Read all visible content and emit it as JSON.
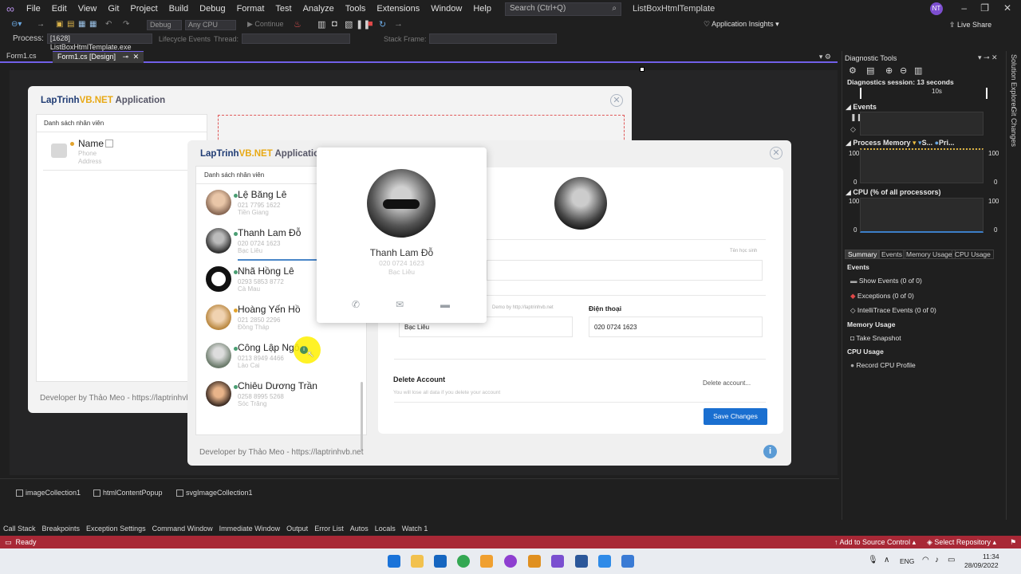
{
  "menubar": {
    "items": [
      "File",
      "Edit",
      "View",
      "Git",
      "Project",
      "Build",
      "Debug",
      "Format",
      "Test",
      "Analyze",
      "Tools",
      "Extensions",
      "Window",
      "Help"
    ],
    "search_placeholder": "Search (Ctrl+Q)",
    "window_title": "ListBoxHtmlTemplate",
    "user_initials": "NT",
    "app_insights": "Application Insights",
    "live_share": "Live Share"
  },
  "toolbar": {
    "debug_combo": "Debug",
    "cpu_combo": "Any CPU",
    "continue_label": "Continue",
    "process_label": "Process:",
    "process_value": "[1628] ListBoxHtmlTemplate.exe",
    "lifecycle_label": "Lifecycle Events",
    "thread_label": "Thread:",
    "stackframe_label": "Stack Frame:"
  },
  "tabs": [
    {
      "label": "Form1.cs"
    },
    {
      "label": "Form1.cs [Design]"
    }
  ],
  "back_window": {
    "title_part1": "LapTrinh",
    "title_part2": "VB.NET",
    "title_part3": " Application",
    "panel_title": "Danh sách nhân viên",
    "item_name": "Name",
    "item_phone": "Phone",
    "item_address": "Address",
    "footer": "Developer by Thảo Meo - https://laptrinhvb.n"
  },
  "front_window": {
    "title_part1": "LapTrinh",
    "title_part2": "VB.NET",
    "title_part3": " Applicatio",
    "panel_title": "Danh sách nhân viên",
    "footer": "Developer by Thảo Meo - https://laptrinhvb.net",
    "employees": [
      {
        "name": "Lệ Băng Lê",
        "phone": "021 7795 1622",
        "address": "Tiền Giang"
      },
      {
        "name": "Thanh Lam Đỗ",
        "phone": "020 0724 1623",
        "address": "Bạc Liêu"
      },
      {
        "name": "Nhã Hồng Lê",
        "phone": "0293 5853 8772",
        "address": "Cà Mau"
      },
      {
        "name": "Hoàng Yến Hồ",
        "phone": "021 2850 2296",
        "address": "Đồng Tháp"
      },
      {
        "name": "Công Lập Ngô",
        "phone": "0213 8949 4466",
        "address": "Lào Cai"
      },
      {
        "name": "Chiêu Dương Trần",
        "phone": "0258 8995 5268",
        "address": "Sóc Trăng"
      }
    ]
  },
  "popup": {
    "name": "Thanh Lam Đỗ",
    "phone": "020 0724 1623",
    "address": "Bạc Liêu"
  },
  "detail": {
    "small_label": "Tên học sinh",
    "demo_text": "Demo by http://laptrinhvb.net",
    "phone_label": "Điện thoại",
    "address_value": "Bạc Liêu",
    "phone_value": "020 0724 1623",
    "delete_title": "Delete Account",
    "delete_sub": "You will lose all data if you delete your account",
    "delete_link": "Delete account...",
    "save_label": "Save Changes"
  },
  "tray": {
    "items": [
      "imageCollection1",
      "htmlContentPopup",
      "svgImageCollection1"
    ]
  },
  "diagnostics": {
    "title": "Diagnostic Tools",
    "session": "Diagnostics session: 13 seconds",
    "time_label": "10s",
    "events_label": "Events",
    "process_memory": "Process Memory",
    "pm_legend1": "S...",
    "pm_legend2": "Pri...",
    "cpu_label": "CPU (% of all processors)",
    "y_max": "100",
    "y_min": "0",
    "tabs": [
      "Summary",
      "Events",
      "Memory Usage",
      "CPU Usage"
    ],
    "events_head": "Events",
    "show_events": "Show Events (0 of 0)",
    "exceptions": "Exceptions (0 of 0)",
    "intellitrace": "IntelliTrace Events (0 of 0)",
    "memory_head": "Memory Usage",
    "take_snapshot": "Take Snapshot",
    "cpu_head": "CPU Usage",
    "record_cpu": "Record CPU Profile"
  },
  "side_tabs": [
    "Solution Explorer",
    "Git Changes"
  ],
  "bottom_tabs": [
    "Call Stack",
    "Breakpoints",
    "Exception Settings",
    "Command Window",
    "Immediate Window",
    "Output",
    "Error List",
    "Autos",
    "Locals",
    "Watch 1"
  ],
  "status": {
    "ready": "Ready",
    "source_control": "Add to Source Control",
    "repository": "Select Repository"
  },
  "taskbar": {
    "lang": "ENG",
    "time": "11:34",
    "date": "28/09/2022"
  },
  "colors": {
    "accent": "#7160e8",
    "status_bar": "#a82836",
    "save_button": "#1a6fd0",
    "vb_orange": "#e8a915"
  }
}
